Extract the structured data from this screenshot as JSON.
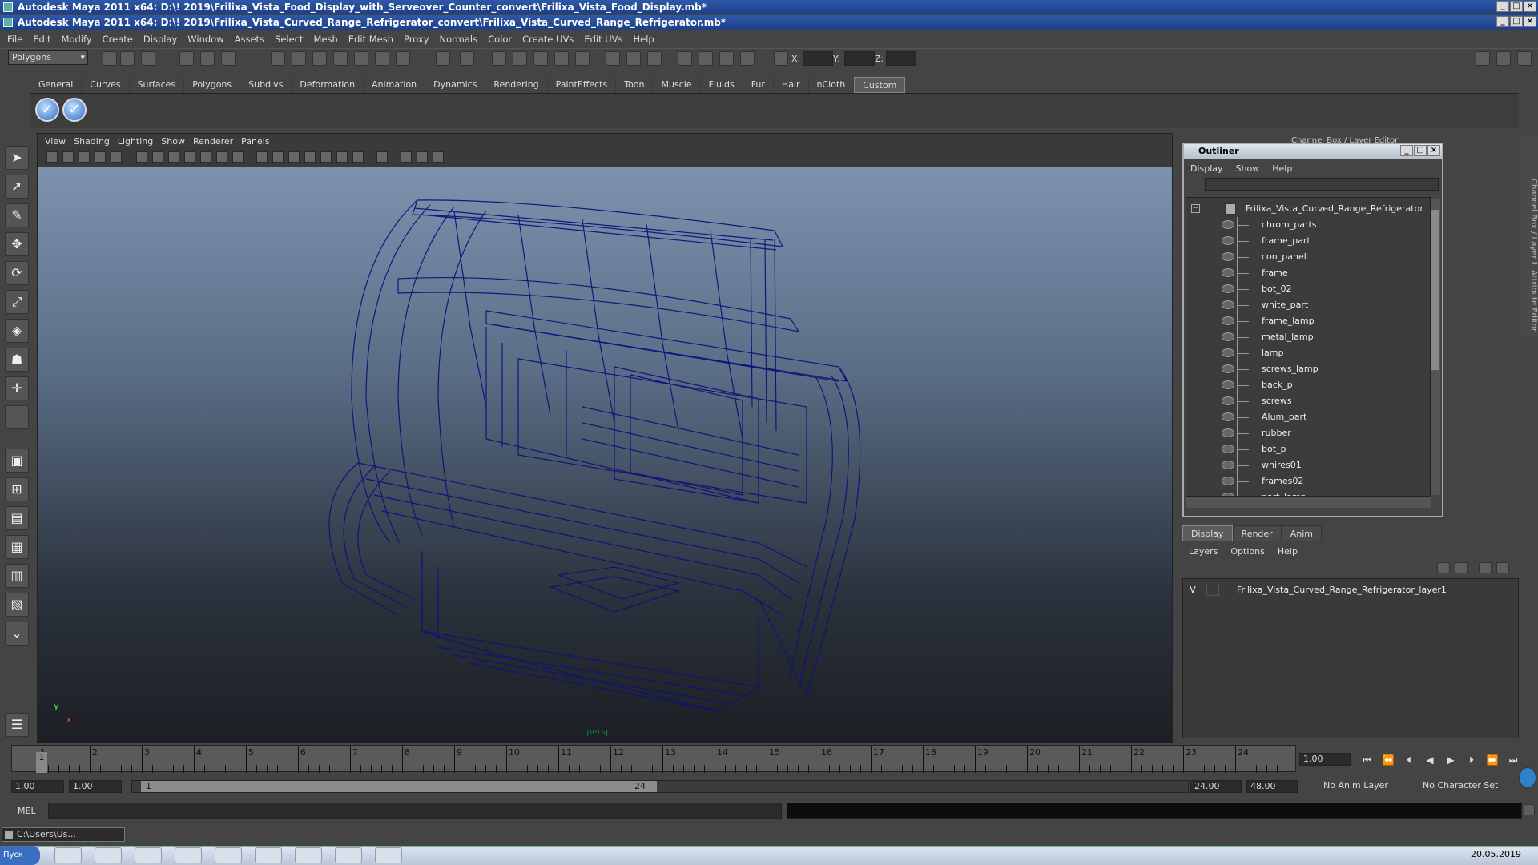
{
  "window_titles": {
    "back": "Autodesk Maya 2011 x64: D:\\! 2019\\Frilixa_Vista_Food_Display_with_Serveover_Counter_convert\\Frilixa_Vista_Food_Display.mb*",
    "front": "Autodesk Maya 2011 x64: D:\\! 2019\\Frilixa_Vista_Curved_Range_Refrigerator_convert\\Frilixa_Vista_Curved_Range_Refrigerator.mb*"
  },
  "main_menu": [
    "File",
    "Edit",
    "Modify",
    "Create",
    "Display",
    "Window",
    "Assets",
    "Select",
    "Mesh",
    "Edit Mesh",
    "Proxy",
    "Normals",
    "Color",
    "Create UVs",
    "Edit UVs",
    "Help"
  ],
  "status_line": {
    "mode": "Polygons",
    "x_label": "X:",
    "y_label": "Y:",
    "z_label": "Z:"
  },
  "shelf_tabs": [
    "General",
    "Curves",
    "Surfaces",
    "Polygons",
    "Subdivs",
    "Deformation",
    "Animation",
    "Dynamics",
    "Rendering",
    "PaintEffects",
    "Toon",
    "Muscle",
    "Fluids",
    "Fur",
    "Hair",
    "nCloth",
    "Custom"
  ],
  "active_shelf_tab": "Custom",
  "viewport": {
    "menu": [
      "View",
      "Shading",
      "Lighting",
      "Show",
      "Renderer",
      "Panels"
    ],
    "camera_label": "persp",
    "axis_x": "x",
    "axis_y": "y"
  },
  "channel_box_title": "Channel Box / Layer Editor",
  "side_tabs": {
    "channel_box": "Channel Box / Layer Editor",
    "attribute_editor": "Attribute Editor"
  },
  "outliner": {
    "title": "Outliner",
    "menu": [
      "Display",
      "Show",
      "Help"
    ],
    "root": "Frilixa_Vista_Curved_Range_Refrigerator",
    "items": [
      "chrom_parts",
      "frame_part",
      "con_panel",
      "frame",
      "bot_02",
      "white_part",
      "frame_lamp",
      "metal_lamp",
      "lamp",
      "screws_lamp",
      "back_p",
      "screws",
      "Alum_part",
      "rubber",
      "bot_p",
      "whires01",
      "frames02",
      "part_lamp"
    ]
  },
  "layer_editor": {
    "tabs": [
      "Display",
      "Render",
      "Anim"
    ],
    "active_tab": "Display",
    "menu": [
      "Layers",
      "Options",
      "Help"
    ],
    "layers": [
      {
        "visible": "V",
        "name": "Frilixa_Vista_Curved_Range_Refrigerator_layer1"
      }
    ]
  },
  "timeline": {
    "ticks": [
      "1",
      "2",
      "3",
      "4",
      "5",
      "6",
      "7",
      "8",
      "9",
      "10",
      "11",
      "12",
      "13",
      "14",
      "15",
      "16",
      "17",
      "18",
      "19",
      "20",
      "21",
      "22",
      "23",
      "24"
    ],
    "current_frame": "1.00",
    "current_marker": "1"
  },
  "range": {
    "start_time": "1.00",
    "playback_start": "1.00",
    "slider_start": "1",
    "slider_end": "24",
    "playback_end": "24.00",
    "end_time": "48.00",
    "anim_layer": "No Anim Layer",
    "character_set": "No Character Set"
  },
  "command_line": {
    "label": "MEL"
  },
  "minimized_window": "C:\\Users\\Us...",
  "taskbar": {
    "start": "Пуск",
    "date": "20.05.2019"
  }
}
